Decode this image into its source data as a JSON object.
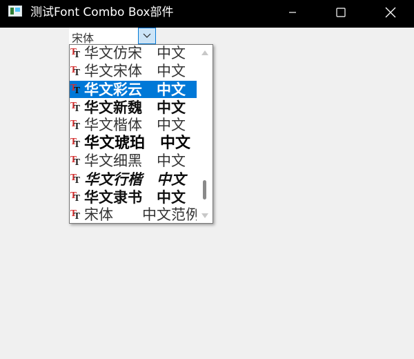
{
  "window": {
    "title": "测试Font Combo Box部件",
    "controls": [
      "minimize",
      "maximize",
      "close"
    ]
  },
  "combo": {
    "value": "宋体",
    "button_icon": "chevron-down-icon"
  },
  "dropdown": {
    "items": [
      {
        "label": "华文仿宋　中文",
        "style": "normal",
        "selected": false
      },
      {
        "label": "华文宋体　中文",
        "style": "normal",
        "selected": false
      },
      {
        "label": "华文彩云　中文",
        "style": "outline",
        "selected": true
      },
      {
        "label": "华文新魏　中文",
        "style": "bold",
        "selected": false
      },
      {
        "label": "华文楷体　中文",
        "style": "normal",
        "selected": false
      },
      {
        "label": "华文琥珀　中文",
        "style": "black",
        "selected": false
      },
      {
        "label": "华文细黑　中文",
        "style": "normal",
        "selected": false
      },
      {
        "label": "华文行楷　中文",
        "style": "italic",
        "selected": false
      },
      {
        "label": "华文隶书　中文",
        "style": "bold",
        "selected": false
      },
      {
        "label": "宋体　　中文范例",
        "style": "normal",
        "selected": false
      }
    ],
    "item_icon": "truetype-font-icon"
  },
  "colors": {
    "selection": "#0078d7",
    "titlebar": "#000000",
    "background": "#f0f0f0"
  }
}
